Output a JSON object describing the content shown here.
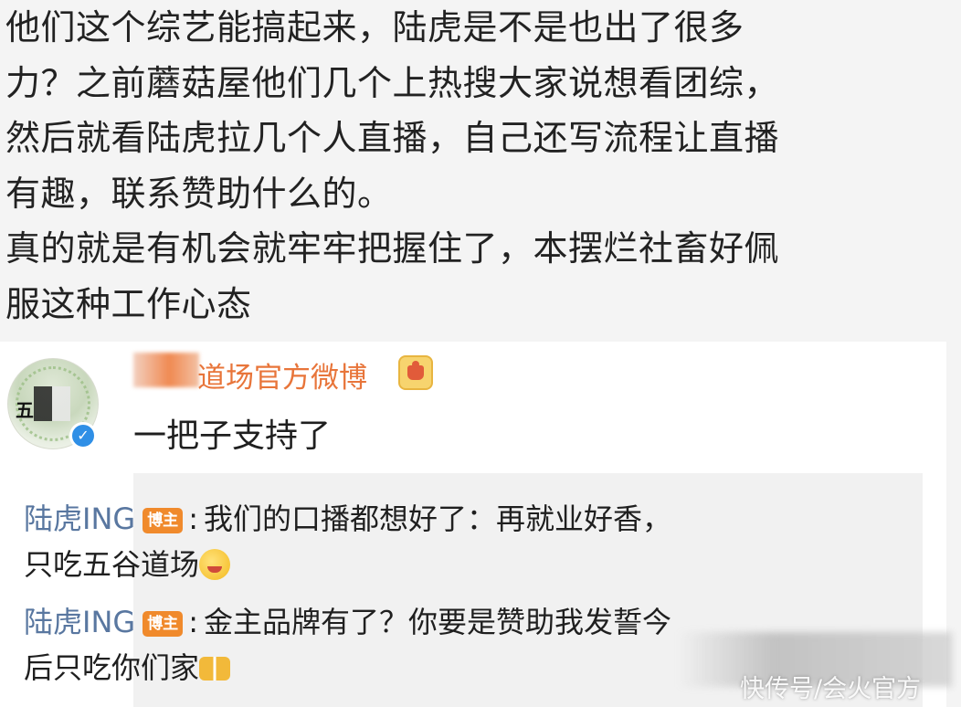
{
  "post": {
    "lines": [
      "他们这个综艺能搞起来，陆虎是不是也出了很多",
      "力？之前蘑菇屋他们几个上热搜大家说想看团综，",
      "然后就看陆虎拉几个人直播，自己还写流程让直播",
      "有趣，联系赞助什么的。",
      "真的就是有机会就牢牢把握住了，本摆烂社畜好佩",
      "服这种工作心态"
    ]
  },
  "comment": {
    "author_name": "道场官方微博",
    "author_icon": "crown-icon",
    "avatar_icon": "verified-icon",
    "avatar_text": "五",
    "verified_mark": "✓",
    "text": "一把子支持了"
  },
  "replies": [
    {
      "user": "陆虎ING",
      "badge": "博主",
      "colon": ":",
      "line1": "我们的口播都想好了：再就业好香，",
      "line2": "只吃五谷道场",
      "emoji": "drool-emoji"
    },
    {
      "user": "陆虎ING",
      "badge": "博主",
      "colon": ":",
      "line1": "金主品牌有了？你要是赞助我发誓今",
      "line2": "后只吃你们家",
      "emoji": "bow-emoji"
    }
  ],
  "watermark": {
    "text": "快传号/会火官方"
  },
  "colors": {
    "author_name": "#e8753a",
    "reply_user": "#5977a0",
    "host_badge": "#f08a2c",
    "verified": "#2f8fe6"
  }
}
